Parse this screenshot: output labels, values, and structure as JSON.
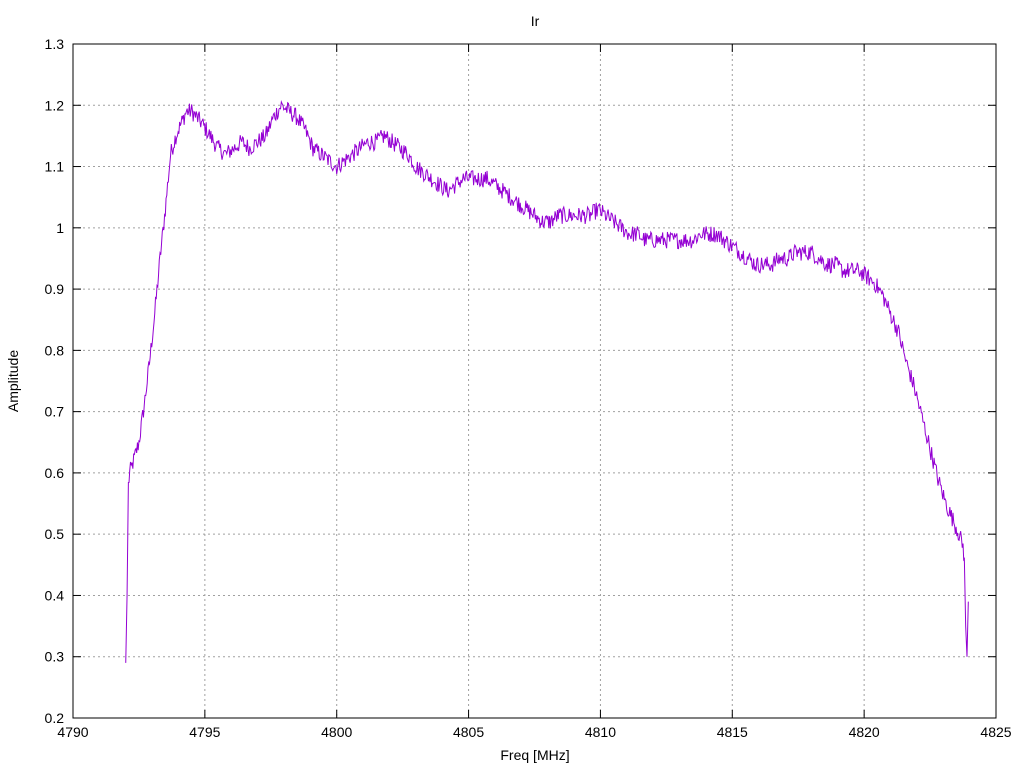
{
  "chart_data": {
    "type": "line",
    "title": "Ir",
    "xlabel": "Freq [MHz]",
    "ylabel": "Amplitude",
    "xlim": [
      4790,
      4825
    ],
    "ylim": [
      0.2,
      1.3
    ],
    "x_ticks": [
      "4790",
      "4795",
      "4800",
      "4805",
      "4810",
      "4815",
      "4820",
      "4825"
    ],
    "y_ticks": [
      "0.2",
      "0.3",
      "0.4",
      "0.5",
      "0.6",
      "0.7",
      "0.8",
      "0.9",
      "1",
      "1.1",
      "1.2",
      "1.3"
    ],
    "grid": true,
    "series_color": "#9400d3",
    "series": [
      {
        "x": [
          4792.0,
          4792.05,
          4792.1,
          4792.15,
          4792.3,
          4792.5,
          4792.7,
          4792.9,
          4793.1,
          4793.3,
          4793.5,
          4793.7,
          4793.9,
          4794.1,
          4794.3,
          4794.5,
          4794.7,
          4794.9,
          4795.2,
          4795.5,
          4795.8,
          4796.1,
          4796.4,
          4796.7,
          4797.0,
          4797.3,
          4797.6,
          4797.9,
          4798.2,
          4798.5,
          4798.8,
          4799.1,
          4799.4,
          4799.7,
          4800.0,
          4800.3,
          4800.6,
          4800.9,
          4801.2,
          4801.5,
          4801.8,
          4802.1,
          4802.4,
          4802.7,
          4803.0,
          4803.3,
          4803.6,
          4803.9,
          4804.2,
          4804.5,
          4804.8,
          4805.1,
          4805.4,
          4805.7,
          4806.0,
          4806.3,
          4806.6,
          4806.9,
          4807.2,
          4807.5,
          4807.8,
          4808.1,
          4808.4,
          4808.7,
          4809.0,
          4809.3,
          4809.6,
          4809.9,
          4810.2,
          4810.5,
          4810.8,
          4811.1,
          4811.4,
          4811.7,
          4812.0,
          4812.3,
          4812.6,
          4812.9,
          4813.2,
          4813.5,
          4813.8,
          4814.1,
          4814.4,
          4814.7,
          4815.0,
          4815.3,
          4815.6,
          4815.9,
          4816.2,
          4816.5,
          4816.8,
          4817.1,
          4817.4,
          4817.7,
          4818.0,
          4818.3,
          4818.6,
          4818.9,
          4819.2,
          4819.5,
          4819.8,
          4820.1,
          4820.4,
          4820.7,
          4821.0,
          4821.3,
          4821.6,
          4821.9,
          4822.2,
          4822.5,
          4822.8,
          4823.1,
          4823.4,
          4823.6,
          4823.75,
          4823.8,
          4823.85,
          4823.9,
          4823.95
        ],
        "values": [
          0.29,
          0.4,
          0.58,
          0.6,
          0.62,
          0.65,
          0.71,
          0.78,
          0.86,
          0.95,
          1.03,
          1.12,
          1.15,
          1.17,
          1.19,
          1.19,
          1.18,
          1.17,
          1.15,
          1.13,
          1.12,
          1.13,
          1.14,
          1.13,
          1.14,
          1.15,
          1.18,
          1.2,
          1.19,
          1.18,
          1.16,
          1.13,
          1.12,
          1.11,
          1.1,
          1.11,
          1.12,
          1.13,
          1.14,
          1.14,
          1.15,
          1.14,
          1.13,
          1.12,
          1.1,
          1.09,
          1.08,
          1.07,
          1.06,
          1.07,
          1.08,
          1.08,
          1.08,
          1.08,
          1.07,
          1.06,
          1.05,
          1.04,
          1.03,
          1.02,
          1.01,
          1.01,
          1.02,
          1.02,
          1.02,
          1.02,
          1.02,
          1.03,
          1.02,
          1.01,
          1.0,
          0.99,
          0.99,
          0.98,
          0.98,
          0.98,
          0.98,
          0.98,
          0.98,
          0.98,
          0.99,
          0.99,
          0.99,
          0.98,
          0.97,
          0.96,
          0.95,
          0.94,
          0.94,
          0.94,
          0.95,
          0.95,
          0.96,
          0.96,
          0.96,
          0.95,
          0.94,
          0.94,
          0.93,
          0.93,
          0.93,
          0.92,
          0.91,
          0.89,
          0.86,
          0.83,
          0.78,
          0.74,
          0.69,
          0.64,
          0.59,
          0.55,
          0.52,
          0.5,
          0.48,
          0.46,
          0.35,
          0.3,
          0.39
        ]
      }
    ]
  }
}
